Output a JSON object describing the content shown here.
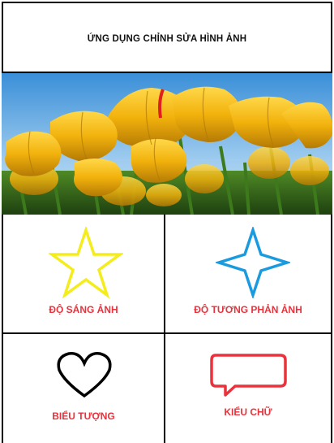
{
  "app": {
    "title": "ỨNG DỤNG CHỈNH SỬA HÌNH ẢNH"
  },
  "photo": {
    "name": "yellow-tulips-photo"
  },
  "menu": [
    {
      "label": "ĐỘ SÁNG ẢNH",
      "icon": "star-icon",
      "color": "#f5ec1c"
    },
    {
      "label": "ĐỘ TƯƠNG PHẢN ẢNH",
      "icon": "four-point-star-icon",
      "color": "#1a9be0"
    },
    {
      "label": "BIỂU TƯỢNG",
      "icon": "heart-icon",
      "color": "#000000"
    },
    {
      "label": "KIỂU CHỮ",
      "icon": "speech-bubble-icon",
      "color": "#e8323c"
    }
  ]
}
